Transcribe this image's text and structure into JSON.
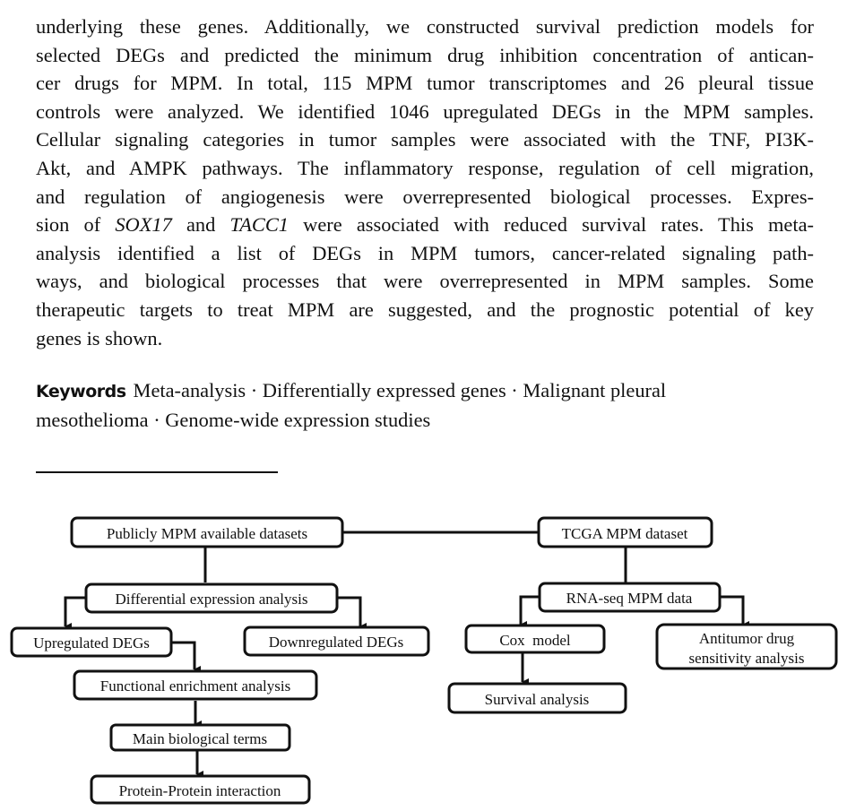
{
  "abstract": {
    "lines": [
      "underlying these genes. Additionally, we constructed survival prediction models for",
      "selected DEGs and predicted the minimum drug inhibition concentration of antican-",
      "cer drugs for MPM. In total, 115 MPM tumor transcriptomes and 26 pleural tissue",
      "controls were analyzed. We identified 1046 upregulated DEGs in the MPM samples.",
      "Cellular signaling categories in tumor samples were associated with the TNF, PI3K-",
      "Akt, and AMPK pathways. The inflammatory response, regulation of cell migration,",
      "and regulation of angiogenesis were overrepresented biological processes. Expres-",
      {
        "pre": "sion of ",
        "gene1": "SOX17",
        "mid": " and ",
        "gene2": "TACC1",
        "post": " were associated with reduced survival rates. This meta-"
      },
      "analysis identified a list of DEGs in MPM tumors, cancer-related signaling path-",
      "ways, and biological processes that were overrepresented in MPM samples. Some",
      "therapeutic targets to treat MPM are suggested, and the prognostic potential of key",
      "genes is shown."
    ]
  },
  "keywords": {
    "label": "Keywords",
    "line1": "Meta-analysis · Differentially expressed genes · Malignant pleural",
    "line2": "mesothelioma · Genome-wide expression studies"
  },
  "flowchart": {
    "nodes": {
      "public_datasets": "Publicly MPM available datasets",
      "tcga_dataset": "TCGA MPM dataset",
      "differential_expression": "Differential expression analysis",
      "rnaseq_data": "RNA-seq MPM data",
      "upregulated": "Upregulated DEGs",
      "downregulated": "Downregulated DEGs",
      "cox_model": "Cox  model",
      "antitumor_line1": "Antitumor drug",
      "antitumor_line2": "sensitivity analysis",
      "functional_enrichment": "Functional enrichment analysis",
      "survival": "Survival analysis",
      "main_terms": "Main biological terms",
      "ppi": "Protein-Protein interaction"
    }
  }
}
